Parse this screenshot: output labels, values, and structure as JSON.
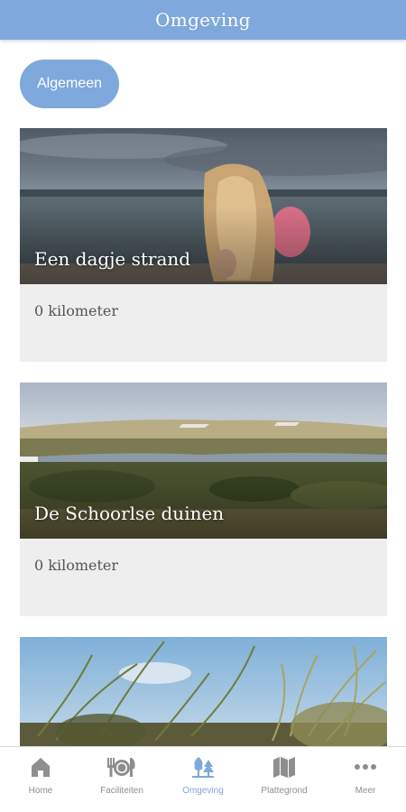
{
  "header": {
    "title": "Omgeving"
  },
  "filter": {
    "chip_label": "Algemeen"
  },
  "cards": [
    {
      "title": "Een dagje strand",
      "distance": "0 kilometer"
    },
    {
      "title": "De Schoorlse duinen",
      "distance": "0 kilometer"
    },
    {
      "title": "",
      "distance": ""
    }
  ],
  "tabbar": {
    "active": "Omgeving",
    "items": [
      {
        "label": "Home",
        "icon": "home-icon"
      },
      {
        "label": "Faciliteiten",
        "icon": "cutlery-icon"
      },
      {
        "label": "Omgeving",
        "icon": "trees-icon"
      },
      {
        "label": "Plattegrond",
        "icon": "map-icon"
      },
      {
        "label": "Meer",
        "icon": "more-dots-icon"
      }
    ]
  },
  "colors": {
    "accent": "#7fa8dc",
    "inactive": "#8e8e8e",
    "card_background": "#eeeeee"
  }
}
